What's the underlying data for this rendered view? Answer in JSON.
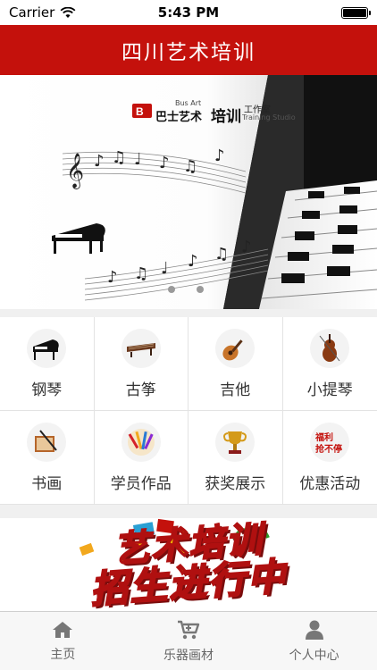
{
  "status_bar": {
    "carrier": "Carrier",
    "time": "5:43 PM"
  },
  "nav": {
    "title": "四川艺术培训"
  },
  "banner": {
    "logo_en_top": "Bus Art",
    "logo_cn": "巴士艺术",
    "logo_peixun": "培训",
    "logo_studio_cn": "工作室",
    "logo_studio_en": "Training Studio",
    "page_count": 2
  },
  "categories": [
    {
      "label": "钢琴",
      "icon": "piano-icon"
    },
    {
      "label": "古筝",
      "icon": "guzheng-icon"
    },
    {
      "label": "吉他",
      "icon": "guitar-icon"
    },
    {
      "label": "小提琴",
      "icon": "violin-icon"
    },
    {
      "label": "书画",
      "icon": "calligraphy-icon"
    },
    {
      "label": "学员作品",
      "icon": "brushes-icon"
    },
    {
      "label": "获奖展示",
      "icon": "trophy-icon"
    },
    {
      "label": "优惠活动",
      "icon": "discount-icon"
    }
  ],
  "promo": {
    "line1": "艺术培训",
    "line2": "招生进行中"
  },
  "tabs": [
    {
      "label": "主页",
      "icon": "home-icon"
    },
    {
      "label": "乐器画材",
      "icon": "cart-icon"
    },
    {
      "label": "个人中心",
      "icon": "person-icon"
    }
  ],
  "colors": {
    "brand_red": "#c4110c",
    "tab_gray": "#777777"
  }
}
